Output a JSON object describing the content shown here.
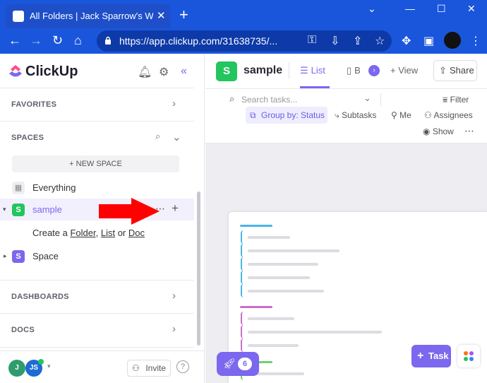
{
  "browser": {
    "tab_title": "All Folders | Jack Sparrow's Works",
    "new_tab_symbol": "+",
    "url": "https://app.clickup.com/31638735/...",
    "window_controls": [
      "⌄",
      "—",
      "☐",
      "✕"
    ]
  },
  "sidebar": {
    "logo_text": "ClickUp",
    "favorites_label": "FAVORITES",
    "spaces_label": "SPACES",
    "new_space_label": "+ NEW SPACE",
    "everything_label": "Everything",
    "space_sample": {
      "avatar": "S",
      "label": "sample",
      "color": "#22c55e"
    },
    "create_prefix": "Create a ",
    "create_folder": "Folder",
    "create_sep1": ", ",
    "create_list": "List",
    "create_sep2": " or ",
    "create_doc": "Doc",
    "space_other": {
      "avatar": "S",
      "label": "Space",
      "color": "#7b68ee"
    },
    "dashboards_label": "DASHBOARDS",
    "docs_label": "DOCS",
    "avatar_j": "J",
    "avatar_js": "JS",
    "invite_label": "Invite"
  },
  "main": {
    "space_avatar": "S",
    "space_name": "sample",
    "list_tab": "List",
    "board_tab": "B",
    "view_label": "+ View",
    "share_label": "Share",
    "search_placeholder": "Search tasks...",
    "filter_label": "Filter",
    "group_by_label": "Group by: Status",
    "subtasks_label": "Subtasks",
    "me_label": "Me",
    "assignees_label": "Assignees",
    "show_label": "Show",
    "rocket_count": "6",
    "task_button": "Task"
  },
  "colors": {
    "accent": "#7b68ee",
    "chrome": "#1a56db",
    "arrow": "#ff0000"
  }
}
